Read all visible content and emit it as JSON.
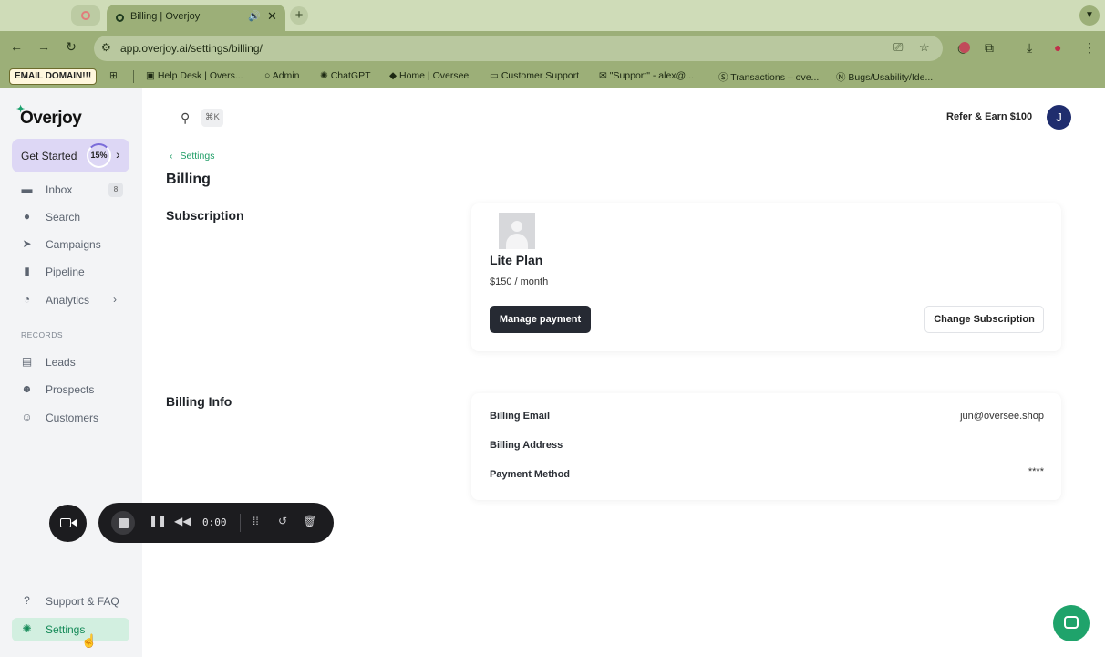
{
  "browser": {
    "tab_title": "Billing | Overjoy",
    "tab_speaker_icon": "speaker-icon",
    "url": "app.overjoy.ai/settings/billing/",
    "bookmarks": [
      {
        "label": "EMAIL DOMAIN!!!"
      },
      {
        "label": "Help Desk | Overs..."
      },
      {
        "label": "Admin"
      },
      {
        "label": "ChatGPT"
      },
      {
        "label": "Home | Oversee"
      },
      {
        "label": "Customer Support"
      },
      {
        "label": "\"Support\" - alex@..."
      },
      {
        "label": "Transactions – ove..."
      },
      {
        "label": "Bugs/Usability/Ide..."
      }
    ]
  },
  "sidebar": {
    "logo": "Overjoy",
    "get_started": {
      "label": "Get Started",
      "progress": "15%"
    },
    "items": [
      {
        "label": "Inbox",
        "badge": "8",
        "icon": "inbox-icon"
      },
      {
        "label": "Search",
        "icon": "search-icon"
      },
      {
        "label": "Campaigns",
        "icon": "send-icon"
      },
      {
        "label": "Pipeline",
        "icon": "pipeline-icon"
      },
      {
        "label": "Analytics",
        "icon": "chart-icon"
      }
    ],
    "records_heading": "RECORDS",
    "records": [
      {
        "label": "Leads",
        "icon": "contact-card-icon"
      },
      {
        "label": "Prospects",
        "icon": "people-icon"
      },
      {
        "label": "Customers",
        "icon": "customers-icon"
      }
    ],
    "bottom": [
      {
        "label": "Support & FAQ",
        "icon": "help-icon"
      },
      {
        "label": "Settings",
        "icon": "gear-icon",
        "active": true
      }
    ]
  },
  "topbar": {
    "search_shortcut": "⌘K",
    "refer": "Refer & Earn $100",
    "avatar_initial": "J"
  },
  "main": {
    "breadcrumb": "Settings",
    "page_title": "Billing",
    "subscription": {
      "heading": "Subscription",
      "plan_name": "Lite Plan",
      "price": "$150 / month",
      "manage_button": "Manage payment",
      "change_button": "Change Subscription"
    },
    "billing_info": {
      "heading": "Billing Info",
      "rows": [
        {
          "label": "Billing Email",
          "value": "jun@oversee.shop"
        },
        {
          "label": "Billing Address",
          "value": ""
        },
        {
          "label": "Payment Method",
          "value": "****"
        }
      ]
    }
  },
  "recorder": {
    "time": "0:00"
  },
  "colors": {
    "accent": "#1aa06d",
    "sidebar_bg": "#f3f4f6",
    "browser_frame": "#9caf78"
  }
}
